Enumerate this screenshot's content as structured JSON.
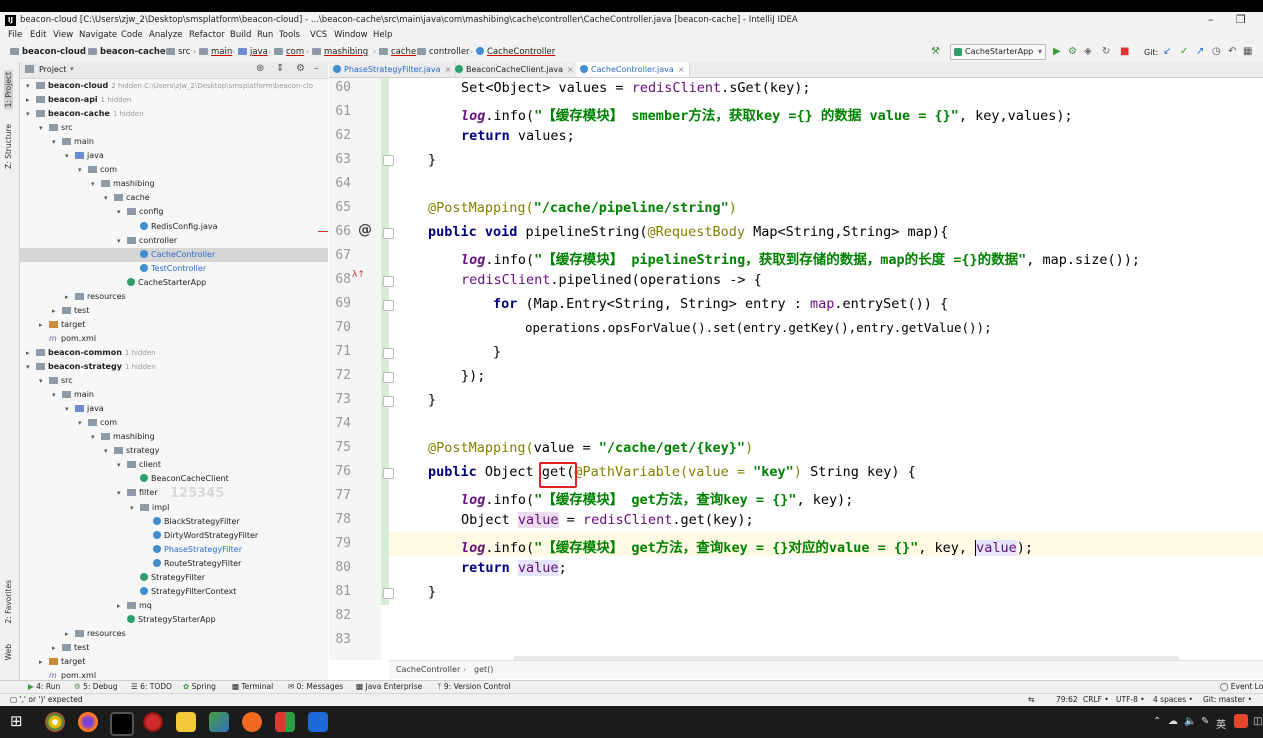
{
  "window": {
    "title": "beacon-cloud [C:\\Users\\zjw_2\\Desktop\\smsplatform\\beacon-cloud] - ...\\beacon-cache\\src\\main\\java\\com\\mashibing\\cache\\controller\\CacheController.java [beacon-cache] - IntelliJ IDEA",
    "logo": "IJ"
  },
  "menu": [
    "File",
    "Edit",
    "View",
    "Navigate",
    "Code",
    "Analyze",
    "Refactor",
    "Build",
    "Run",
    "Tools",
    "VCS",
    "Window",
    "Help"
  ],
  "breadcrumb": [
    "beacon-cloud",
    "beacon-cache",
    "src",
    "main",
    "java",
    "com",
    "mashibing",
    "cache",
    "controller",
    "CacheController"
  ],
  "run_config": "CacheStarterApp",
  "git_label": "Git:",
  "project_panel": {
    "title": "Project",
    "tree": [
      {
        "label": "beacon-cloud",
        "hint": "2 hidden  C:\\Users\\zjw_2\\Desktop\\smsplatform\\beacon-clo",
        "bold": true
      },
      {
        "label": "beacon-api",
        "hint": "1 hidden",
        "bold": true
      },
      {
        "label": "beacon-cache",
        "hint": "1 hidden",
        "bold": true
      },
      {
        "label": "src"
      },
      {
        "label": "main"
      },
      {
        "label": "java"
      },
      {
        "label": "com"
      },
      {
        "label": "mashibing"
      },
      {
        "label": "cache"
      },
      {
        "label": "config"
      },
      {
        "label": "RedisConfig.java"
      },
      {
        "label": "controller"
      },
      {
        "label": "CacheController"
      },
      {
        "label": "TestController"
      },
      {
        "label": "CacheStarterApp"
      },
      {
        "label": "resources"
      },
      {
        "label": "test"
      },
      {
        "label": "target"
      },
      {
        "label": "pom.xml"
      },
      {
        "label": "beacon-common",
        "hint": "1 hidden",
        "bold": true
      },
      {
        "label": "beacon-strategy",
        "hint": "1 hidden",
        "bold": true
      },
      {
        "label": "src"
      },
      {
        "label": "main"
      },
      {
        "label": "java"
      },
      {
        "label": "com"
      },
      {
        "label": "mashibing"
      },
      {
        "label": "strategy"
      },
      {
        "label": "client"
      },
      {
        "label": "BeaconCacheClient"
      },
      {
        "label": "filter"
      },
      {
        "label": "impl"
      },
      {
        "label": "BlackStrategyFilter"
      },
      {
        "label": "DirtyWordStrategyFilter"
      },
      {
        "label": "PhaseStrategyFilter"
      },
      {
        "label": "RouteStrategyFilter"
      },
      {
        "label": "StrategyFilter"
      },
      {
        "label": "StrategyFilterContext"
      },
      {
        "label": "mq"
      },
      {
        "label": "StrategyStarterApp"
      },
      {
        "label": "resources"
      },
      {
        "label": "test"
      },
      {
        "label": "target"
      },
      {
        "label": "pom.xml"
      }
    ],
    "watermark": "125345"
  },
  "side_tabs": [
    "1: Project",
    "Z: Structure",
    "2: Favorites",
    "Web"
  ],
  "editor_tabs": [
    "PhaseStrategyFilter.java",
    "BeaconCacheClient.java",
    "CacheController.java"
  ],
  "line_numbers": [
    "60",
    "61",
    "62",
    "63",
    "64",
    "65",
    "66",
    "67",
    "68",
    "69",
    "70",
    "71",
    "72",
    "73",
    "74",
    "75",
    "76",
    "77",
    "78",
    "79",
    "80",
    "81",
    "82",
    "83"
  ],
  "code": {
    "l60a": "Set<Object> values = ",
    "l60b": "redisClient",
    "l60c": ".sGet(key);",
    "l61a": "log",
    "l61b": ".info(",
    "l61c": "\"【缓存模块】 smember方法，获取key ={} 的数据 value = {}\"",
    "l61d": ", key,values);",
    "l62a": "return",
    "l62b": " values;",
    "l63": "}",
    "l65a": "@PostMapping(",
    "l65b": "\"/cache/pipeline/string\"",
    "l65c": ")",
    "l66a": "public void",
    "l66b": " pipelineString(",
    "l66c": "@RequestBody",
    "l66d": " Map<String,String> map){",
    "l67a": "log",
    "l67b": ".info(",
    "l67c": "\"【缓存模块】 pipelineString，获取到存储的数据，map的长度 ={}的数据\"",
    "l67d": ", map.size());",
    "l68a": "redisClient",
    "l68b": ".pipelined(operations -> {",
    "l69a": "for",
    "l69b": " (Map.Entry<String, String> entry : ",
    "l69c": "map",
    "l69d": ".entrySet()) {",
    "l70": "operations.opsForValue().set(entry.getKey(),entry.getValue());",
    "l71": "}",
    "l72": "});",
    "l73": "}",
    "l75a": "@PostMapping(",
    "l75b": "value = ",
    "l75c": "\"/cache/get/{key}\"",
    "l75d": ")",
    "l76a": "public",
    "l76b": " Object ",
    "l76c": "get",
    "l76d": "(",
    "l76e": "@PathVariable(value = ",
    "l76f": "\"key\"",
    "l76g": ")",
    "l76h": " String key) {",
    "l77a": "log",
    "l77b": ".info(",
    "l77c": "\"【缓存模块】 get方法，查询key = {}\"",
    "l77d": ", key);",
    "l78a": "Object ",
    "l78b": "value",
    "l78c": " = ",
    "l78d": "redisClient",
    "l78e": ".get(key);",
    "l79a": "log",
    "l79b": ".info(",
    "l79c": "\"【缓存模块】 get方法，查询key = {}对应的value = {}\"",
    "l79d": ", key, ",
    "l79e": "value",
    "l79f": ");",
    "l80a": "return",
    "l80b": " ",
    "l80c": "value",
    "l80d": ";",
    "l81": "}"
  },
  "editor_breadcrumb": [
    "CacheController",
    "get()"
  ],
  "tool_windows": [
    "4: Run",
    "5: Debug",
    "6: TODO",
    "Spring",
    "Terminal",
    "0: Messages",
    "Java Enterprise",
    "9: Version Control",
    "Event Log"
  ],
  "status": {
    "message": "',' or ')' expected",
    "position": "79:62",
    "line_sep": "CRLF",
    "encoding": "UTF-8",
    "indent": "4 spaces",
    "git": "Git: master"
  },
  "taskbar": {
    "tray_text": "英"
  }
}
